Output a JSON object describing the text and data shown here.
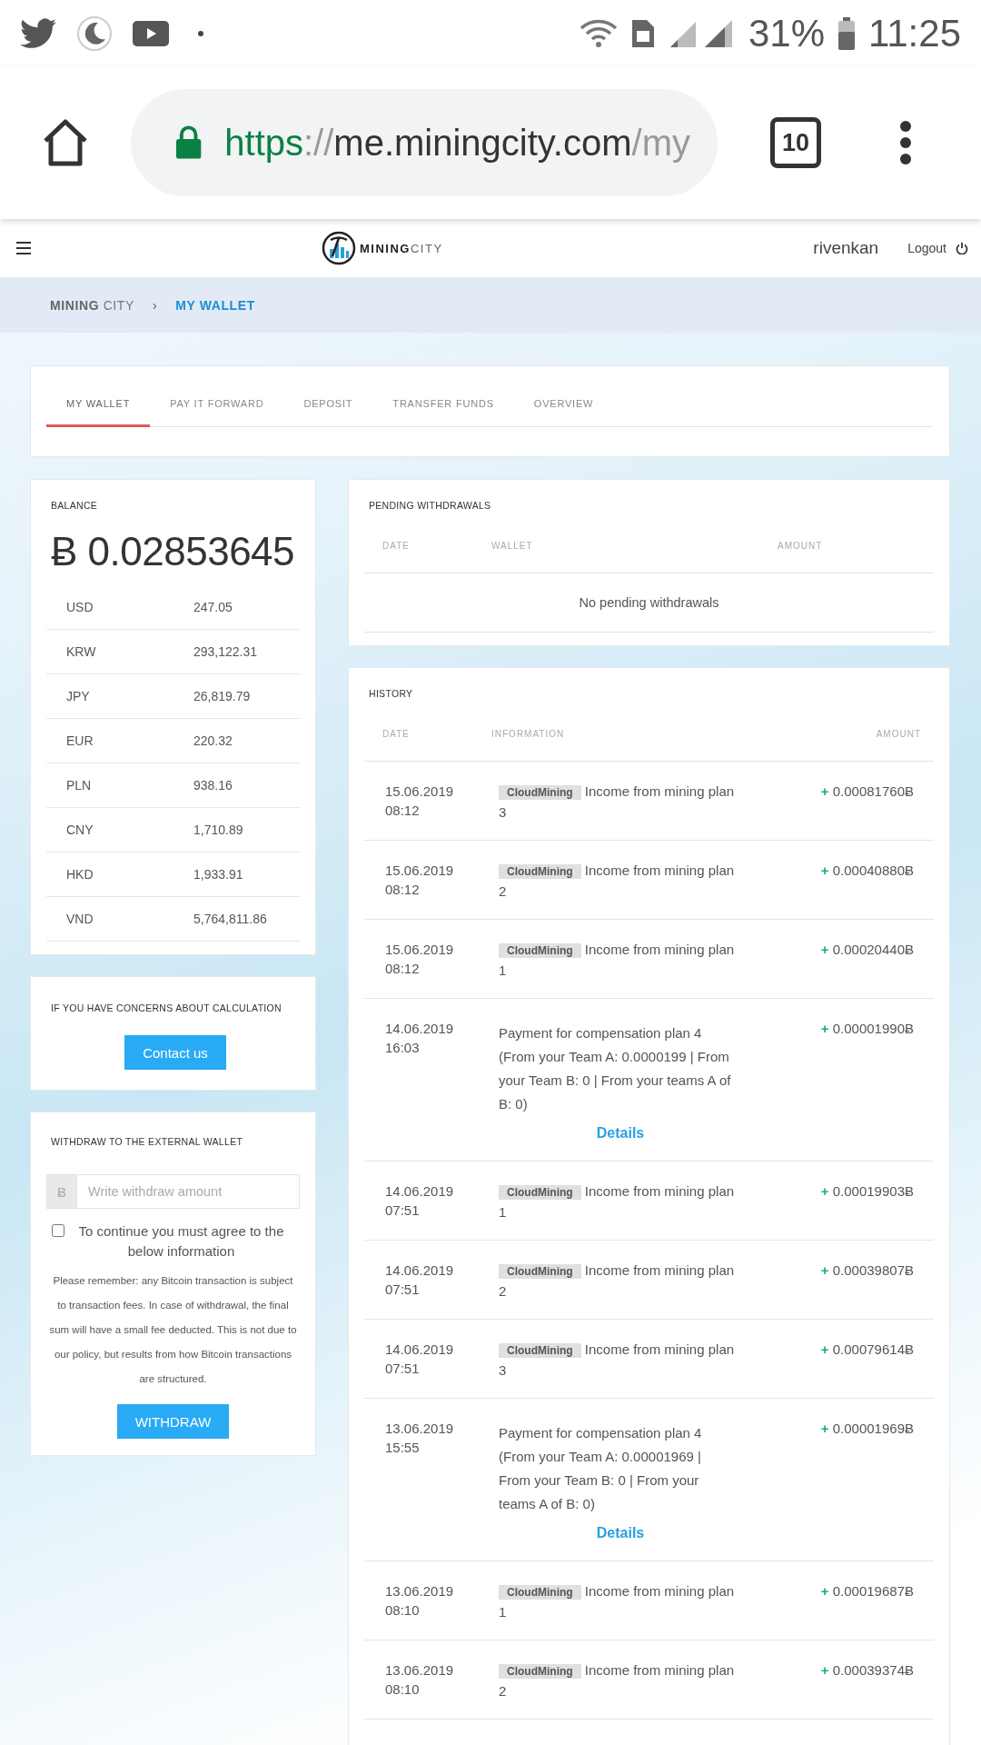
{
  "status_bar": {
    "battery": "31%",
    "time": "11:25"
  },
  "browser": {
    "url_scheme": "https",
    "url_sep": "://",
    "url_host": "me.miningcity.com",
    "url_path": "/my",
    "tab_count": "10"
  },
  "site_header": {
    "logo_bold": "MINING",
    "logo_light": "CITY",
    "username": "rivenkan",
    "logout": "Logout"
  },
  "breadcrumb": {
    "separator": "›",
    "items": [
      {
        "label": "**MINING** CITY",
        "selected": false
      },
      {
        "label": "MY WALLET",
        "selected": true
      }
    ]
  },
  "tabs": [
    {
      "label": "MY WALLET",
      "selected": true
    },
    {
      "label": "PAY IT FORWARD",
      "selected": false
    },
    {
      "label": "DEPOSIT",
      "selected": false
    },
    {
      "label": "TRANSFER FUNDS",
      "selected": false
    },
    {
      "label": "OVERVIEW",
      "selected": false
    }
  ],
  "balance": {
    "title": "BALANCE",
    "symbol": "Ƀ",
    "amount": "0.02853645",
    "rates": [
      {
        "currency": "USD",
        "value": "247.05"
      },
      {
        "currency": "KRW",
        "value": "293,122.31"
      },
      {
        "currency": "JPY",
        "value": "26,819.79"
      },
      {
        "currency": "EUR",
        "value": "220.32"
      },
      {
        "currency": "PLN",
        "value": "938.16"
      },
      {
        "currency": "CNY",
        "value": "1,710.89"
      },
      {
        "currency": "HKD",
        "value": "1,933.91"
      },
      {
        "currency": "VND",
        "value": "5,764,811.86"
      }
    ]
  },
  "concerns": {
    "title": "IF YOU HAVE CONCERNS ABOUT CALCULATION",
    "button": "Contact us"
  },
  "withdraw": {
    "title": "WITHDRAW TO THE EXTERNAL WALLET",
    "prefix": "Ƀ",
    "placeholder": "Write withdraw amount",
    "agree_checked": false,
    "agree_label": "To continue you must agree to the below information",
    "notice": "Please remember: any Bitcoin transaction is subject to transaction fees. In case of withdrawal, the final sum will have a small fee deducted. This is not due to our policy, but results from how Bitcoin transactions are structured.",
    "button": "WITHDRAW"
  },
  "pending": {
    "title": "PENDING WITHDRAWALS",
    "columns": [
      "DATE",
      "WALLET",
      "AMOUNT"
    ],
    "empty": "No pending withdrawals"
  },
  "history": {
    "title": "HISTORY",
    "columns": [
      "DATE",
      "INFORMATION",
      "AMOUNT"
    ],
    "rows": [
      {
        "kind": "income",
        "date": "15.06.2019",
        "time": "08:12",
        "tag": "CloudMining",
        "info": "Income from mining plan 3",
        "sign": "+",
        "amount": "0.00081760Ƀ"
      },
      {
        "kind": "income",
        "date": "15.06.2019",
        "time": "08:12",
        "tag": "CloudMining",
        "info": "Income from mining plan 2",
        "sign": "+",
        "amount": "0.00040880Ƀ"
      },
      {
        "kind": "income",
        "date": "15.06.2019",
        "time": "08:12",
        "tag": "CloudMining",
        "info": "Income from mining plan 1",
        "sign": "+",
        "amount": "0.00020440Ƀ"
      },
      {
        "kind": "payment",
        "date": "14.06.2019",
        "time": "16:03",
        "info": "Payment for compensation plan 4 (From your Team A: 0.0000199 | From your Team B: 0 | From your teams A of B: 0)",
        "details": "Details",
        "sign": "+",
        "amount": "0.00001990Ƀ"
      },
      {
        "kind": "income",
        "date": "14.06.2019",
        "time": "07:51",
        "tag": "CloudMining",
        "info": "Income from mining plan 1",
        "sign": "+",
        "amount": "0.00019903Ƀ"
      },
      {
        "kind": "income",
        "date": "14.06.2019",
        "time": "07:51",
        "tag": "CloudMining",
        "info": "Income from mining plan 2",
        "sign": "+",
        "amount": "0.00039807Ƀ"
      },
      {
        "kind": "income",
        "date": "14.06.2019",
        "time": "07:51",
        "tag": "CloudMining",
        "info": "Income from mining plan 3",
        "sign": "+",
        "amount": "0.00079614Ƀ"
      },
      {
        "kind": "payment",
        "date": "13.06.2019",
        "time": "15:55",
        "info": "Payment for compensation plan 4 (From your Team A: 0.00001969 | From your Team B: 0 | From your teams A of B: 0)",
        "details": "Details",
        "sign": "+",
        "amount": "0.00001969Ƀ"
      },
      {
        "kind": "income",
        "date": "13.06.2019",
        "time": "08:10",
        "tag": "CloudMining",
        "info": "Income from mining plan 1",
        "sign": "+",
        "amount": "0.00019687Ƀ"
      },
      {
        "kind": "income",
        "date": "13.06.2019",
        "time": "08:10",
        "tag": "CloudMining",
        "info": "Income from mining plan 2",
        "sign": "+",
        "amount": "0.00039374Ƀ"
      }
    ]
  }
}
